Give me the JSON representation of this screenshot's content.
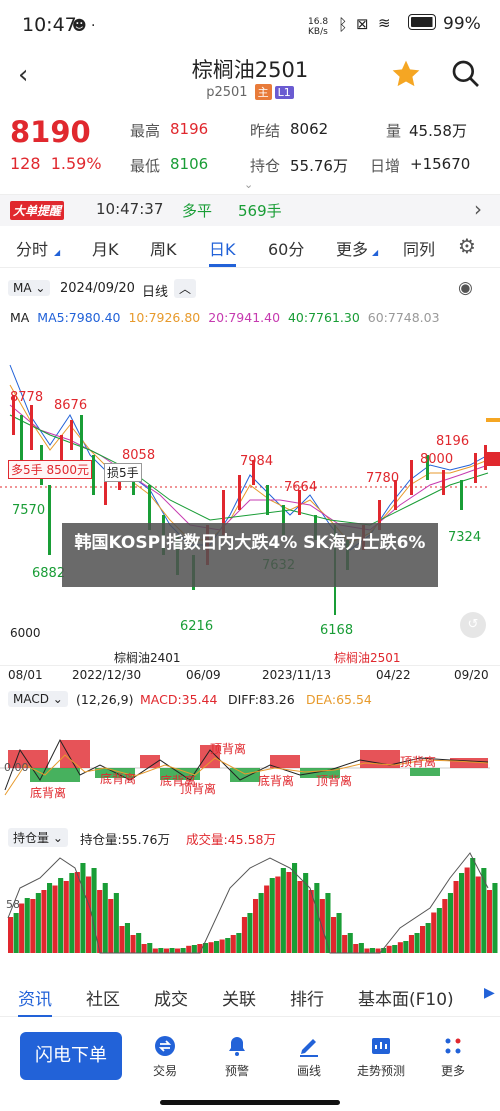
{
  "status": {
    "time": "10:47",
    "net_speed": "16.8 KB/s",
    "battery": "99%"
  },
  "header": {
    "title": "棕榈油2501",
    "code": "p2501",
    "tag_main": "主",
    "tag_l1": "L1"
  },
  "quote": {
    "price": "8190",
    "change": "128",
    "change_pct": "1.59%",
    "high_label": "最高",
    "high": "8196",
    "low_label": "最低",
    "low": "8106",
    "prev_label": "昨结",
    "prev": "8062",
    "oi_label": "持仓",
    "oi": "55.76万",
    "vol_label": "量",
    "vol": "45.58万",
    "daily_label": "日增",
    "daily": "+15670"
  },
  "alert": {
    "badge": "大单提醒",
    "time": "10:47:37",
    "type": "多平",
    "qty": "569手"
  },
  "tabs": [
    "分时",
    "月K",
    "周K",
    "日K",
    "60分",
    "更多",
    "同列"
  ],
  "chart": {
    "ma_label": "MA",
    "date": "2024/09/20",
    "period": "日线",
    "ma_values": [
      "MA",
      "MA5:7980.40",
      "10:7926.80",
      "20:7941.40",
      "40:7761.30",
      "60:7748.03"
    ],
    "ma_colors": [
      "#222",
      "#2262d8",
      "#e79a2c",
      "#c63bb0",
      "#199d36",
      "#999"
    ],
    "annotations": [
      "8778",
      "8676",
      "8058",
      "7984",
      "7664",
      "7780",
      "8000",
      "8196",
      "6882",
      "6216",
      "6168",
      "7324",
      "7570",
      "6000",
      "7632"
    ],
    "tooltip1": "多5手",
    "tooltip2": "8500元",
    "tooltip3": "损5手",
    "contracts": [
      "棕榈油2401",
      "棕榈油2501"
    ],
    "xaxis": [
      "08/01",
      "2022/12/30",
      "06/09",
      "2023/11/13",
      "04/22",
      "09/20"
    ],
    "macd_label": "MACD",
    "macd_params": "(12,26,9)",
    "macd": "MACD:35.44",
    "diff": "DIFF:83.26",
    "dea": "DEA:65.54",
    "macd_notes": [
      "底背离",
      "底背离",
      "顶背离",
      "底背离",
      "顶背离",
      "底背离",
      "顶背离",
      "顶背离"
    ],
    "macd_zero": "0.00",
    "oi_label": "持仓量",
    "oi_text": "持仓量:55.76万",
    "vol_text": "成交量:45.58万",
    "oi_tick": "58"
  },
  "news_banner": "韩国KOSPI指数日内大跌4% SK海力士跌6%",
  "bottom_tabs": [
    "资讯",
    "社区",
    "成交",
    "关联",
    "排行",
    "基本面(F10)"
  ],
  "actions": {
    "flash": "闪电下单",
    "items": [
      "交易",
      "预警",
      "画线",
      "走势预测",
      "更多"
    ]
  }
}
